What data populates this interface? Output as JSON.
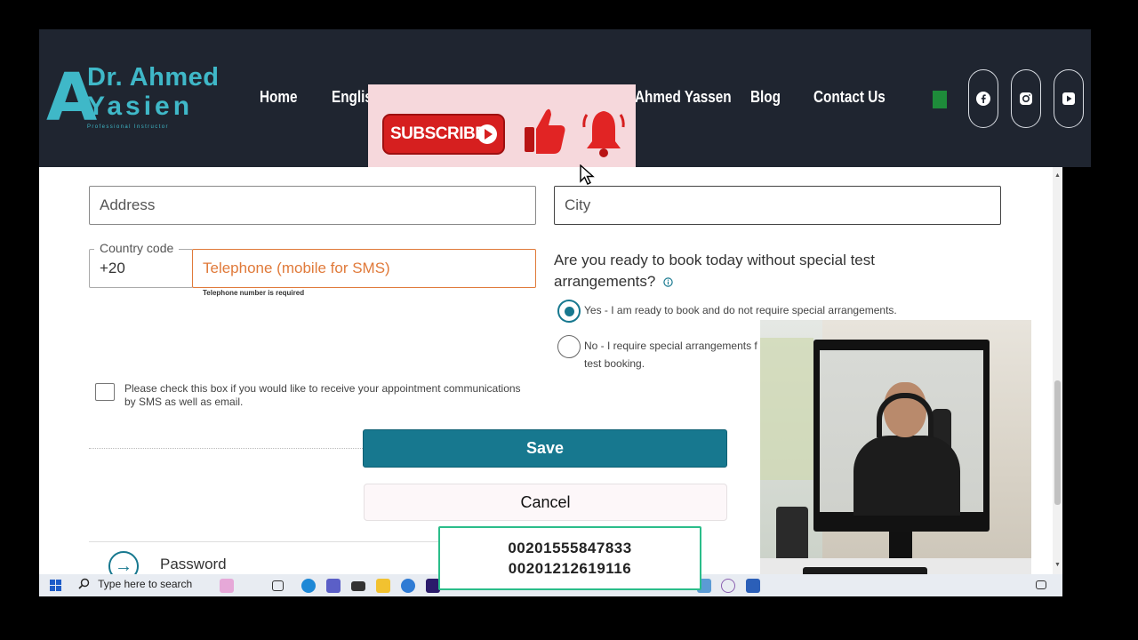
{
  "header": {
    "logo_line1": "Dr. Ahmed",
    "logo_line2": "Yasien",
    "logo_tagline": "Professional Instructor",
    "nav": [
      {
        "label": "Home"
      },
      {
        "label": "English"
      },
      {
        "label": "Ahmed Yassen"
      },
      {
        "label": "Blog"
      },
      {
        "label": "Contact Us"
      }
    ],
    "social_icons": [
      "facebook-icon",
      "instagram-icon",
      "youtube-icon"
    ]
  },
  "subscribe_overlay": {
    "button_label": "SUBSCRIBE",
    "icons": [
      "thumbs-up-icon",
      "bell-icon"
    ]
  },
  "form": {
    "address_placeholder": "Address",
    "city_placeholder": "City",
    "country_code_label": "Country code",
    "country_code_value": "+20",
    "telephone_placeholder": "Telephone (mobile for SMS)",
    "telephone_error": "Telephone number is required",
    "question": "Are you ready to book today without special test arrangements?",
    "question_info_icon": "info-icon",
    "options": [
      {
        "line1": "Yes - I am ready to book and do not require special arrangements.",
        "line2": "",
        "selected": true
      },
      {
        "line1": "No - I require special arrangements f",
        "line2": "test booking.",
        "selected": false
      }
    ],
    "sms_checkbox_label": "Please check this box if you would like to receive your appointment communications by SMS as well as email.",
    "sms_checked": false,
    "save_label": "Save",
    "cancel_label": "Cancel",
    "password_label": "Password"
  },
  "phone_overlay": {
    "line1": "00201555847833",
    "line2": "00201212619116"
  },
  "taskbar": {
    "search_placeholder": "Type here to search"
  },
  "colors": {
    "primary": "#17788f",
    "error_text": "#e07a3a",
    "nav_bg": "#1f2530",
    "logo": "#3fb8c8",
    "subscribe_red": "#d61f1f"
  }
}
